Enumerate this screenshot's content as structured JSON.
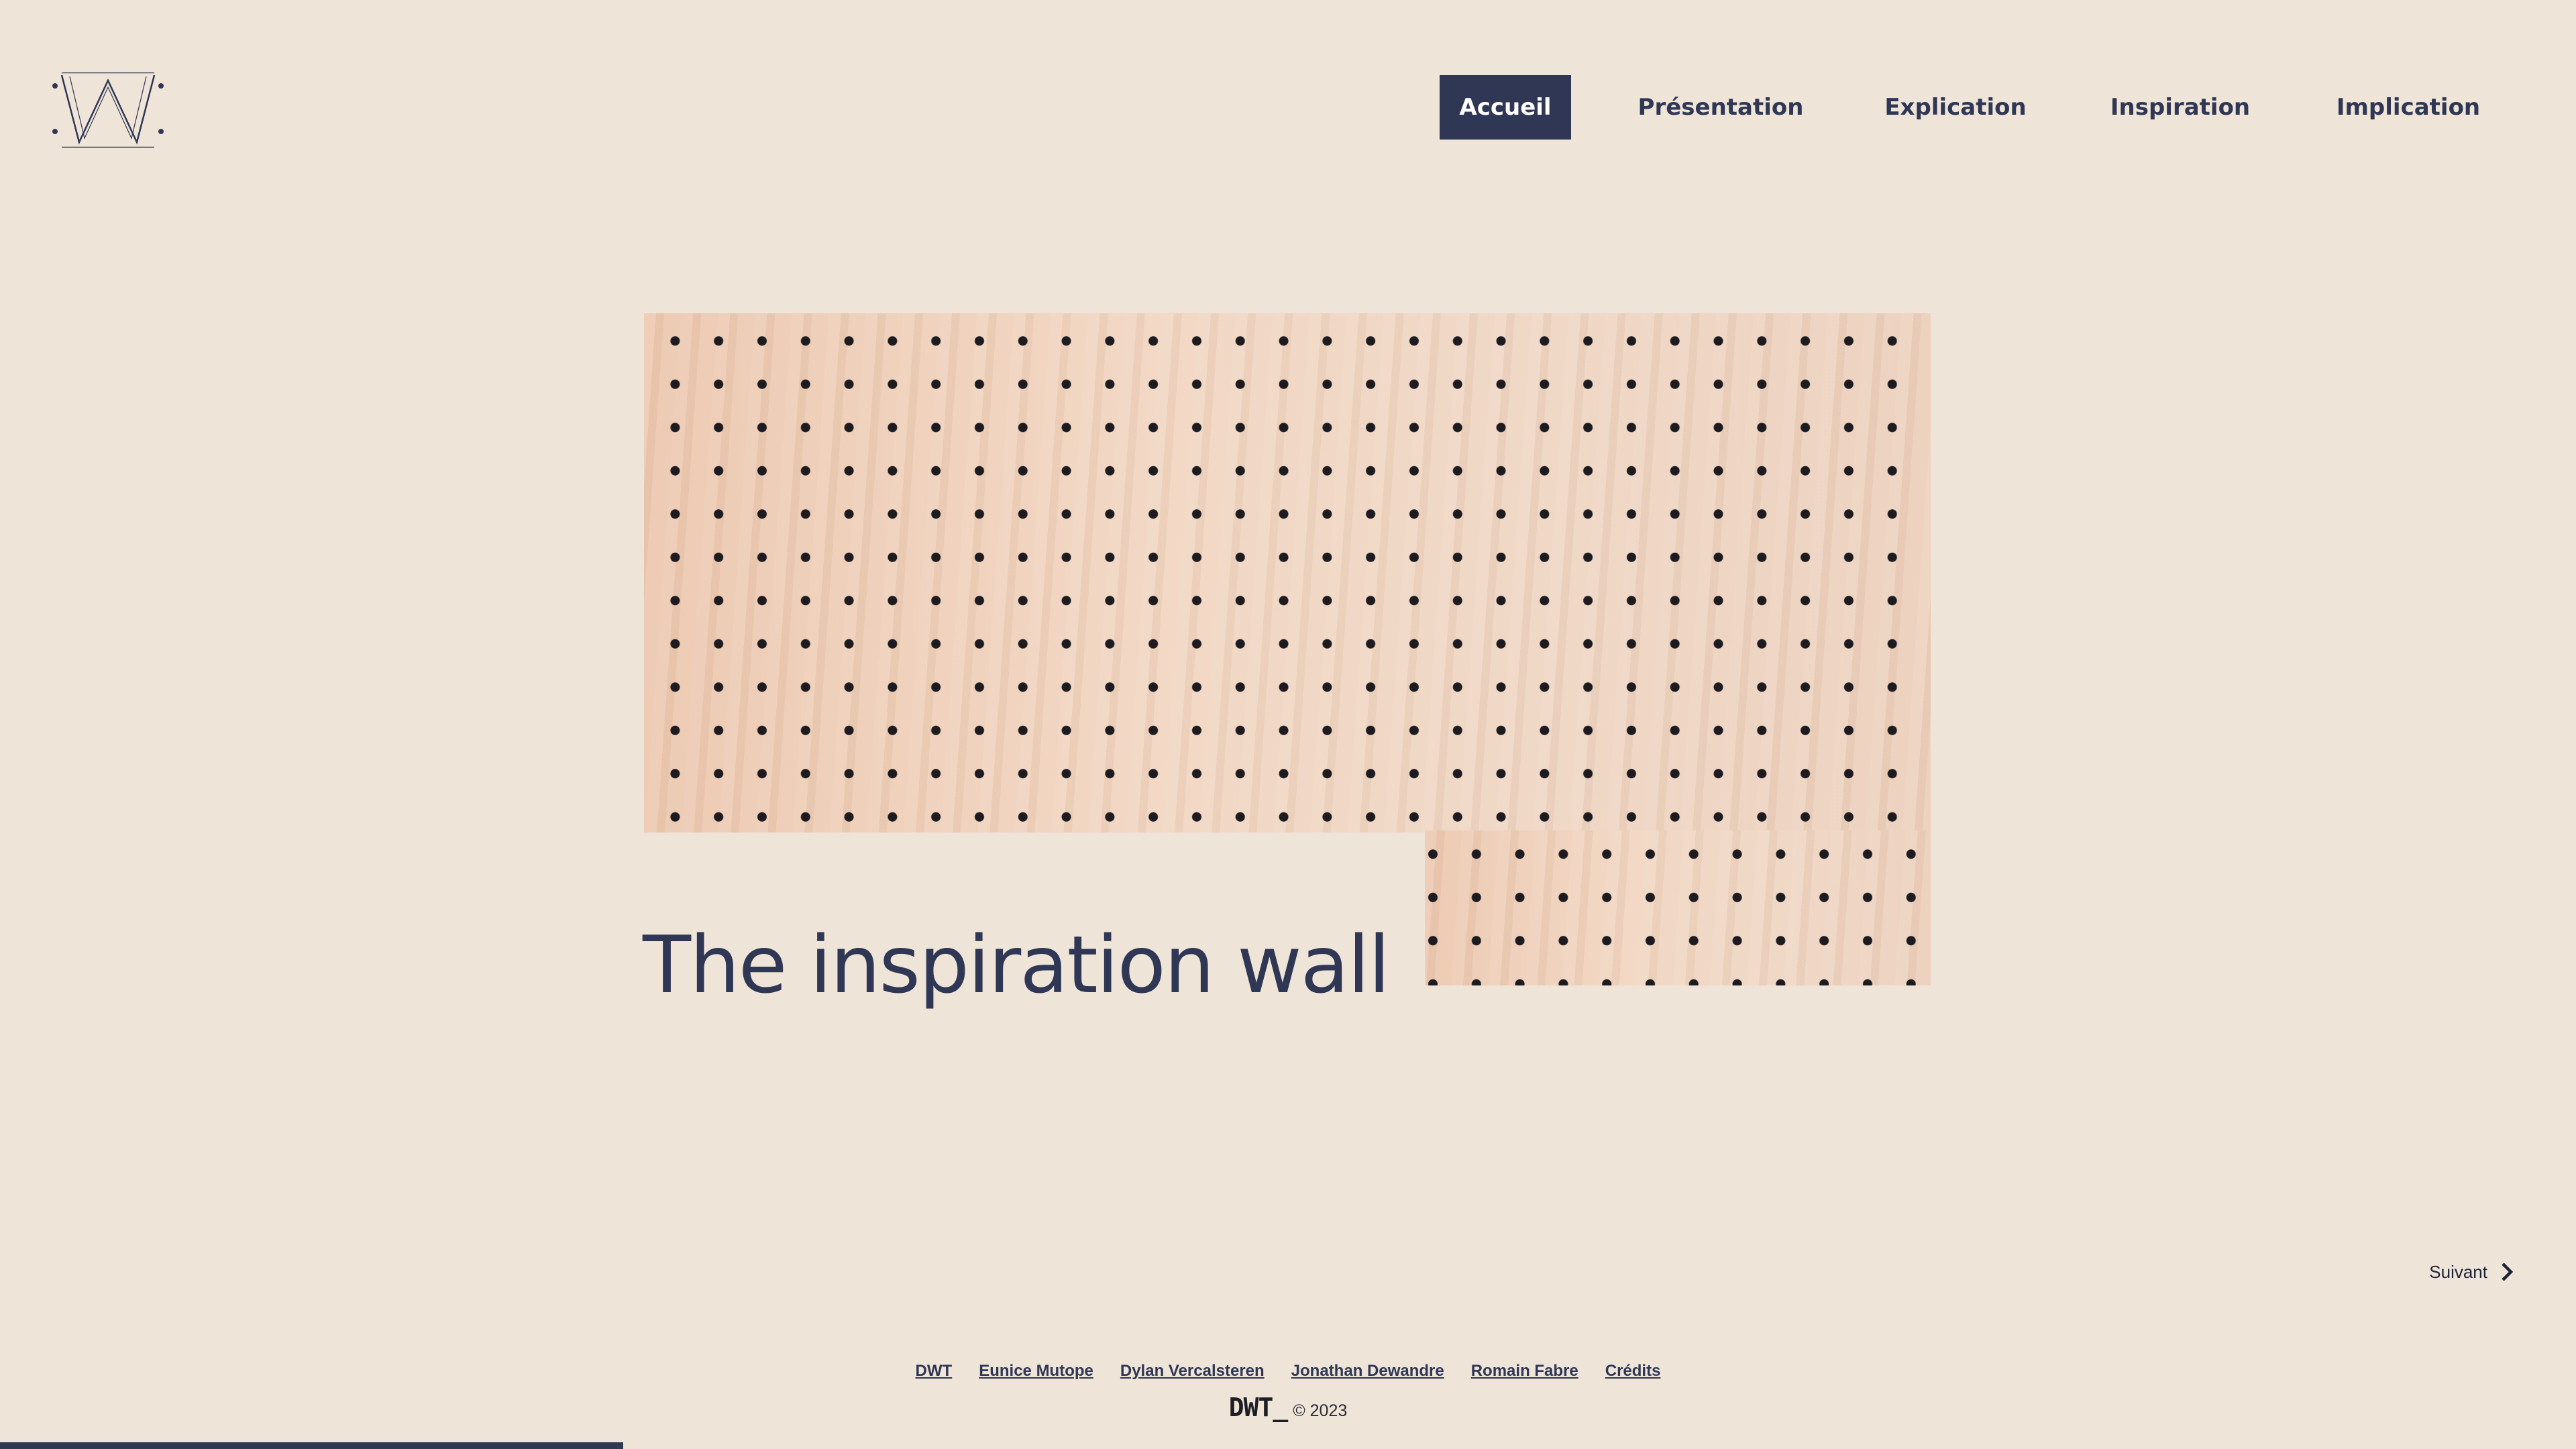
{
  "logo": {
    "icon": "w-logo-icon"
  },
  "nav": {
    "items": [
      {
        "label": "Accueil",
        "active": true
      },
      {
        "label": "Présentation",
        "active": false
      },
      {
        "label": "Explication",
        "active": false
      },
      {
        "label": "Inspiration",
        "active": false
      },
      {
        "label": "Implication",
        "active": false
      }
    ]
  },
  "hero": {
    "title": "The inspiration wall",
    "image": "pegboard-wood-texture"
  },
  "pager": {
    "next_label": "Suivant",
    "icon": "chevron-right-icon"
  },
  "footer": {
    "links": [
      "DWT",
      "Eunice Mutope",
      "Dylan Vercalsteren",
      "Jonathan Dewandre",
      "Romain Fabre",
      "Crédits"
    ],
    "brand": "DWT_",
    "copyright": "© 2023"
  },
  "progress": {
    "fraction": 0.242
  },
  "colors": {
    "background": "#efe4d8",
    "accent": "#2f3754",
    "active_text": "#ffffff"
  }
}
